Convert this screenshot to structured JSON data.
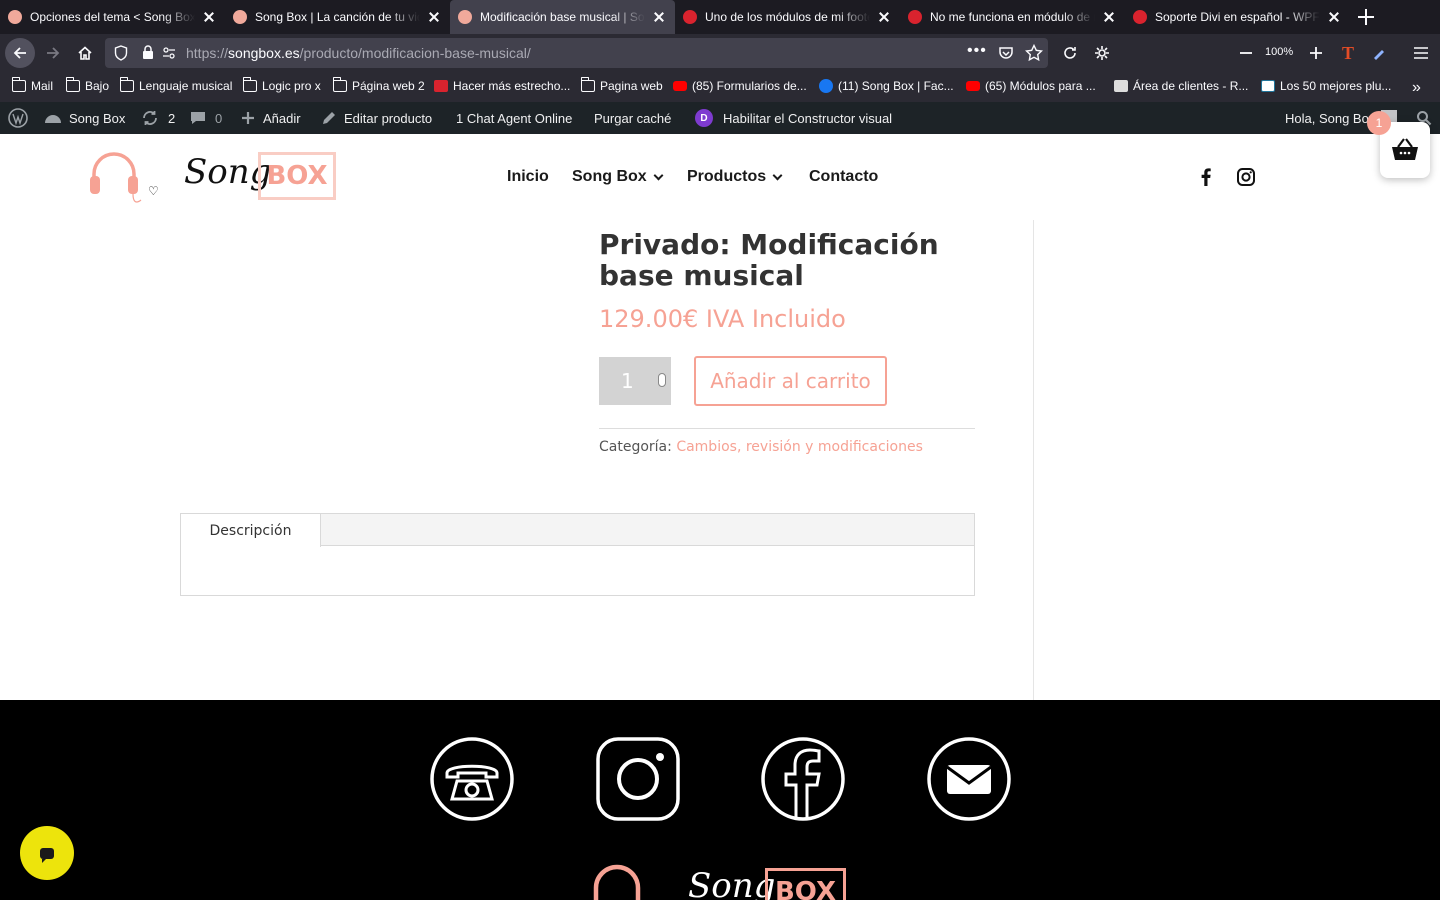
{
  "browser": {
    "tabs": [
      {
        "title": "Opciones del tema < Song Box — WordPress",
        "favicon": "songbox",
        "active": false
      },
      {
        "title": "Song Box | La canción de tu vida",
        "favicon": "songbox",
        "active": false
      },
      {
        "title": "Modificación base musical | Song Box",
        "favicon": "songbox",
        "active": true
      },
      {
        "title": "Uno de los módulos de mi footer",
        "favicon": "wpfacil",
        "active": false
      },
      {
        "title": "No me funciona en módulo de redes",
        "favicon": "wpfacil",
        "active": false
      },
      {
        "title": "Soporte Divi en español - WPFácil",
        "favicon": "wpfacil",
        "active": false
      }
    ],
    "url_prefix": "https://",
    "url_host": "songbox.es",
    "url_path": "/producto/modificacion-base-musical/",
    "zoom": "100%",
    "bookmarks": [
      {
        "label": "Mail",
        "icon": "folder-icon"
      },
      {
        "label": "Bajo",
        "icon": "folder-icon"
      },
      {
        "label": "Lenguaje musical",
        "icon": "folder-icon"
      },
      {
        "label": "Logic pro x",
        "icon": "folder-icon"
      },
      {
        "label": "Página web 2",
        "icon": "folder-icon"
      },
      {
        "label": "Hacer más estrecho...",
        "icon": "wpfacil-icon"
      },
      {
        "label": "Pagina web",
        "icon": "folder-icon"
      },
      {
        "label": "(85) Formularios de...",
        "icon": "youtube-icon"
      },
      {
        "label": "(11) Song Box | Fac...",
        "icon": "facebook-icon"
      },
      {
        "label": "(65) Módulos para ...",
        "icon": "youtube-icon"
      },
      {
        "label": "Área de clientes - R...",
        "icon": "site-icon"
      },
      {
        "label": "Los 50 mejores plu...",
        "icon": "wordpress-icon"
      }
    ]
  },
  "adminbar": {
    "site_name": "Song Box",
    "updates_count": "2",
    "comments_count": "0",
    "add_label": "Añadir",
    "edit_label": "Editar producto",
    "chat_label": "1 Chat Agent Online",
    "purge_label": "Purgar caché",
    "divi_label": "Habilitar el Constructor visual",
    "greeting": "Hola, Song Box"
  },
  "site": {
    "logo_script": "Song",
    "logo_box": "BOX",
    "menu": [
      {
        "label": "Inicio",
        "has_submenu": false
      },
      {
        "label": "Song Box",
        "has_submenu": true
      },
      {
        "label": "Productos",
        "has_submenu": true
      },
      {
        "label": "Contacto",
        "has_submenu": false
      }
    ],
    "cart_count": "1",
    "accent_color": "#f6a294"
  },
  "product": {
    "title": "Privado: Modificación base musical",
    "price": "129.00€ IVA Incluido",
    "quantity": "1",
    "add_to_cart": "Añadir al carrito",
    "category_label": "Categoría:",
    "category_value": "Cambios, revisión y modificaciones",
    "tab_description": "Descripción"
  },
  "footer": {
    "icons": [
      "phone-icon",
      "instagram-icon",
      "facebook-icon",
      "mail-icon"
    ],
    "logo_script": "Song",
    "logo_box": "BOX"
  }
}
